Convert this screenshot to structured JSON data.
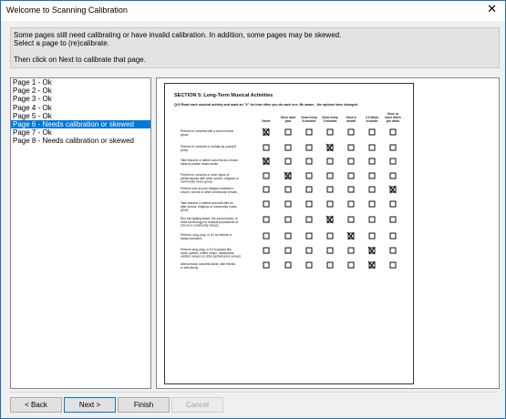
{
  "window": {
    "title": "Welcome to Scanning Calibration",
    "close_glyph": "✕"
  },
  "info": {
    "line1": "Some pages still need calibrating or have invalid calibration. In addition, some pages may be skewed.",
    "line2": "Select a page to (re)calibrate.",
    "line3": "Then click on Next to calibrate that page."
  },
  "pages": [
    {
      "label": "Page 1 - Ok",
      "selected": false
    },
    {
      "label": "Page 2 - Ok",
      "selected": false
    },
    {
      "label": "Page 3 - Ok",
      "selected": false
    },
    {
      "label": "Page 4 - Ok",
      "selected": false
    },
    {
      "label": "Page 5 - Ok",
      "selected": false
    },
    {
      "label": "Page 6 - Needs calibration or skewed",
      "selected": true
    },
    {
      "label": "Page 7 - Ok",
      "selected": false
    },
    {
      "label": "Page 8 - Needs calibration or skewed",
      "selected": false
    }
  ],
  "document": {
    "section_title": "SECTION 5: Long-Term Musical Activities",
    "instruction": "Q10 Read each musical activity and mark an \"X\" for how often you do each one. Be aware - the options have changed.",
    "columns": [
      "Never",
      "Once each year",
      "Once every 6 months",
      "Once every 3 months",
      "Once a month",
      "2-3 times a month",
      "Once or more times per week"
    ],
    "rows": [
      {
        "label": "Perform in concerts with a school music group",
        "marked": 0
      },
      {
        "label": "Perform in concerts or recitals by yourself (solo)",
        "marked": 3
      },
      {
        "label": "Take lessons or attend concerts as a music class at private music studio",
        "marked": 0
      },
      {
        "label": "Perform in concerts or other types of performances with other school, religious or community music group",
        "marked": 1
      },
      {
        "label": "Perform solo at your religious institution, church, school or other community venues",
        "marked": 6
      },
      {
        "label": "Take lessons or attend concerts with an after-school, religious or community music group",
        "marked": -1
      },
      {
        "label": "Run the lighting board, the sound board, or other technology for musical productions at school or community venues",
        "marked": 3
      },
      {
        "label": "Perform, sing, play, or DJ for friends or family members",
        "marked": 4
      },
      {
        "label": "Perform sing, play, or DJ in places like clubs, parties, coffee shops, restaurants, outdoor venues or other performance venues",
        "marked": 5
      },
      {
        "label": "Attend music concerts alone, with friends, or with family",
        "marked": 5
      }
    ]
  },
  "buttons": {
    "back": "< Back",
    "next": "Next >",
    "finish": "Finish",
    "cancel": "Cancel"
  },
  "colors": {
    "selection": "#0078d7",
    "window_border": "#1c6fb8",
    "dialog_bg": "#f0f0f0"
  }
}
